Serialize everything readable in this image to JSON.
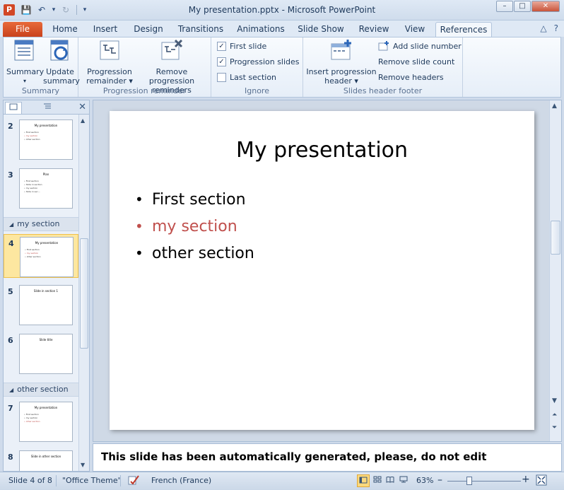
{
  "window": {
    "app_icon": "P",
    "title": "My presentation.pptx - Microsoft PowerPoint",
    "controls": [
      "–",
      "□",
      "✕"
    ]
  },
  "qat": {
    "save_icon": "💾",
    "undo_icon": "↶",
    "undo_drop": "▾",
    "redo_icon": "↻",
    "customize_icon": "▾"
  },
  "tabs": {
    "file": "File",
    "items": [
      "Home",
      "Insert",
      "Design",
      "Transitions",
      "Animations",
      "Slide Show",
      "Review",
      "View",
      "References"
    ],
    "minimize_icon": "△",
    "help_icon": "?"
  },
  "ribbon": {
    "summary_group": {
      "label": "Summary",
      "summary_button": "Summary",
      "summary_drop": "▾",
      "update_button_line1": "Update",
      "update_button_line2": "summary"
    },
    "progression_group": {
      "label": "Progression reminder",
      "reminder_line1": "Progression",
      "reminder_line2": "remainder ▾",
      "remove_line1": "Remove progression",
      "remove_line2": "reminders"
    },
    "ignore_group": {
      "label": "Ignore",
      "first_slide": "First slide",
      "first_slide_checked": "✓",
      "progression_slides": "Progression slides",
      "progression_slides_checked": "✓",
      "last_section": "Last section",
      "last_section_checked": ""
    },
    "header_group": {
      "label": "Slides header  footer",
      "insert_line1": "Insert progression",
      "insert_line2": "header ▾",
      "add_slide_number": "Add slide number",
      "remove_slide_count": "Remove slide count",
      "remove_headers": "Remove headers"
    }
  },
  "panel": {
    "close": "✕",
    "sections": [
      {
        "name": "my section"
      },
      {
        "name": "other section"
      }
    ],
    "thumbs": [
      {
        "num": "2",
        "title": "My presentation",
        "lines": [
          "• First section",
          "• my section",
          "• other section"
        ]
      },
      {
        "num": "3",
        "title": "Plan",
        "lines": [
          "• First section",
          "    • Slide in section",
          "• my section",
          "    • Slide in sec..."
        ]
      },
      {
        "num": "4",
        "title": "My presentation",
        "lines": [
          "• First section",
          "• my section",
          "• other section"
        ]
      },
      {
        "num": "5",
        "title": "Slide in section 1",
        "lines": []
      },
      {
        "num": "6",
        "title": "Slide title",
        "lines": []
      },
      {
        "num": "7",
        "title": "My presentation",
        "lines": [
          "• First section",
          "• my section",
          "• other section"
        ]
      },
      {
        "num": "8",
        "title": "Slide in other section",
        "lines": []
      }
    ]
  },
  "slide": {
    "title": "My presentation",
    "bullets": [
      "First section",
      "my section",
      "other section"
    ],
    "bullet_char": "•"
  },
  "notes": {
    "text": "This slide has been automatically generated, please, do not edit"
  },
  "status": {
    "slide_info": "Slide 4 of 8",
    "theme": "\"Office Theme\"",
    "language": "French (France)",
    "zoom": "63%",
    "zoom_out": "–",
    "zoom_in": "+"
  },
  "colors": {
    "accent_red": "#c0504d",
    "file_tab": "#d24726",
    "selected_thumb": "#fde7a0"
  }
}
